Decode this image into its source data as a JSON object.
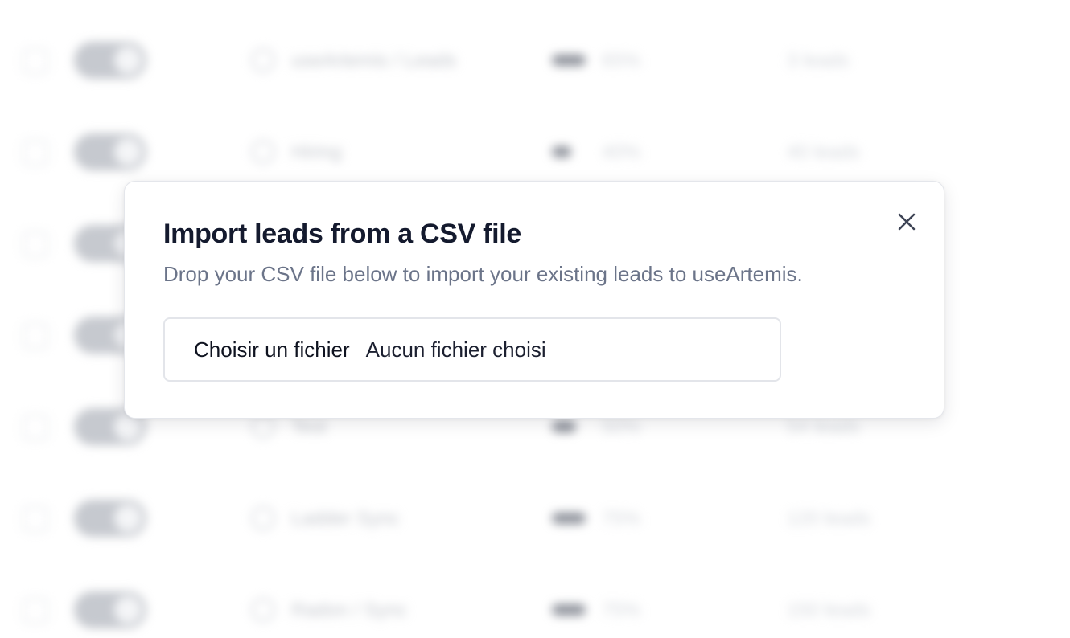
{
  "modal": {
    "title": "Import leads from a CSV file",
    "description": "Drop your CSV file below to import your existing leads to useArtemis.",
    "close_icon": "close-icon",
    "file_input": {
      "button_label": "Choisir un fichier",
      "status_text": "Aucun fichier choisi"
    }
  },
  "background_rows": [
    {
      "name": "useArtemis / Leads",
      "percent": "65%",
      "count": "3 leads"
    },
    {
      "name": "Hiring",
      "percent": "40%",
      "count": "40 leads"
    },
    {
      "name": "",
      "percent": "",
      "count": ""
    },
    {
      "name": "",
      "percent": "",
      "count": ""
    },
    {
      "name": "Test",
      "percent": "50%",
      "count": "54 leads"
    },
    {
      "name": "Ladder Sync",
      "percent": "75%",
      "count": "120 leads"
    },
    {
      "name": "Radon / Sync",
      "percent": "75%",
      "count": "150 leads"
    }
  ],
  "colors": {
    "title": "#141a2e",
    "description": "#6b7489",
    "border": "#e3e5ea"
  }
}
